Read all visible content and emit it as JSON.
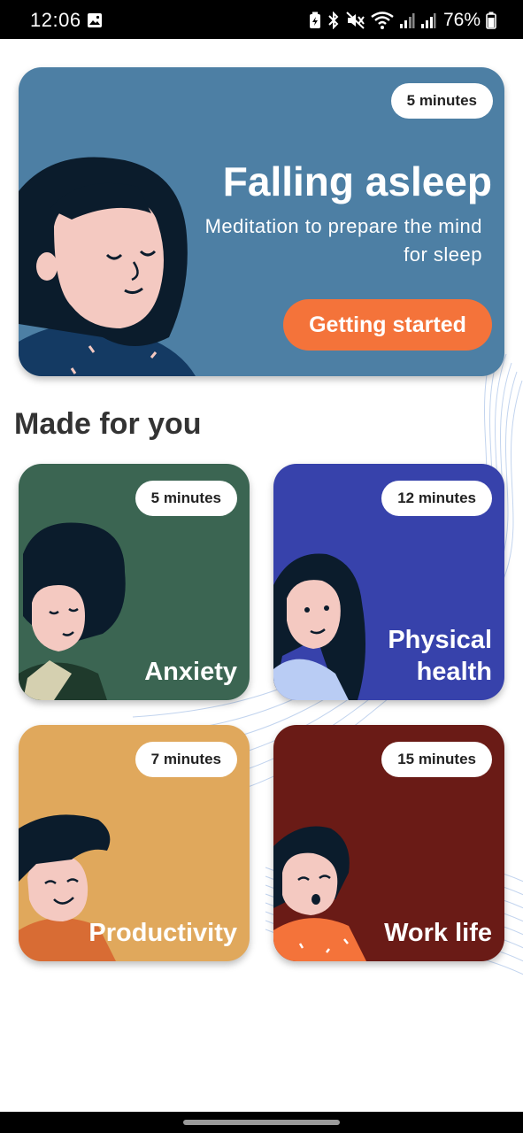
{
  "status_bar": {
    "time": "12:06",
    "battery_percent": "76%"
  },
  "hero": {
    "duration": "5 minutes",
    "title": "Falling asleep",
    "subtitle": "Meditation to prepare the mind for sleep",
    "button_label": "Getting started",
    "background_color": "#4d7fa4",
    "button_color": "#f4733a"
  },
  "section_title": "Made for you",
  "cards": [
    {
      "duration": "5 minutes",
      "title": "Anxiety",
      "color": "#3b6552"
    },
    {
      "duration": "12 minutes",
      "title": "Physical health",
      "color": "#3742ab"
    },
    {
      "duration": "7 minutes",
      "title": "Productivity",
      "color": "#e0a85c"
    },
    {
      "duration": "15 minutes",
      "title": "Work life",
      "color": "#6a1b16"
    }
  ]
}
